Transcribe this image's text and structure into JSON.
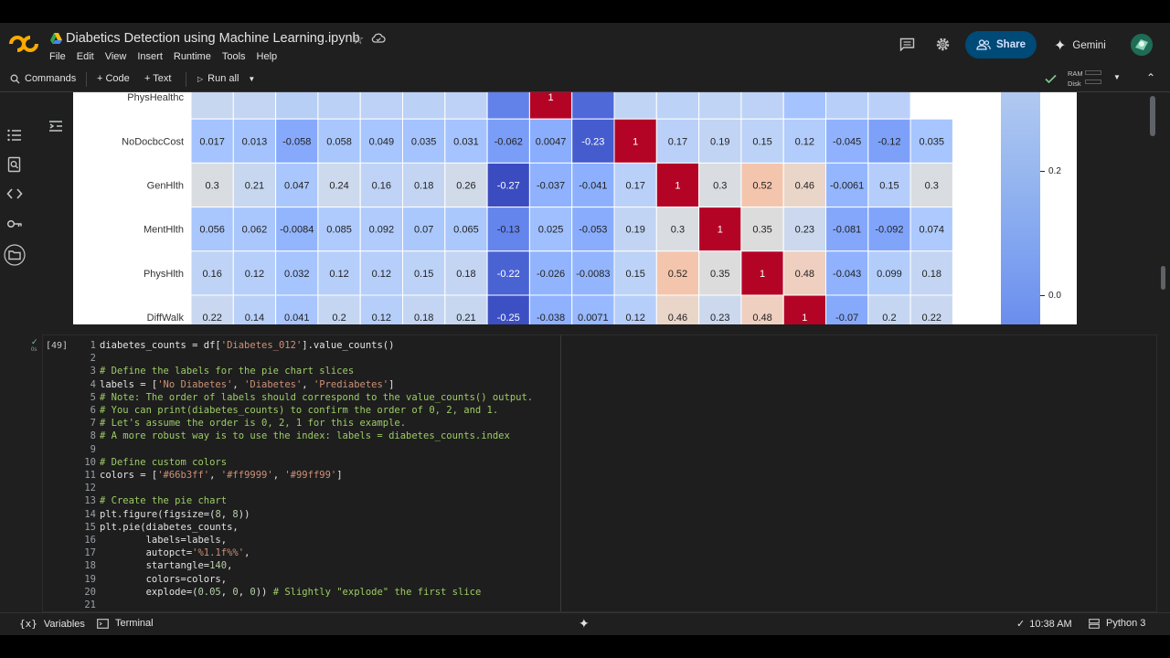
{
  "header": {
    "title": "Diabetics Detection using Machine Learning.ipynb",
    "menu": [
      "File",
      "Edit",
      "View",
      "Insert",
      "Runtime",
      "Tools",
      "Help"
    ],
    "share_label": "Share",
    "gemini_label": "Gemini"
  },
  "toolbar": {
    "commands_label": "Commands",
    "code_label": "+ Code",
    "text_label": "+ Text",
    "run_all_label": "Run all",
    "ram_label": "RAM",
    "disk_label": "Disk"
  },
  "heatmap": {
    "row_labels": [
      "PhysHealthc",
      "NoDocbcCost",
      "GenHlth",
      "MentHlth",
      "PhysHlth",
      "DiffWalk"
    ],
    "rows": [
      {
        "values": [
          "",
          "",
          "",
          "",
          "",
          "",
          "",
          "",
          "1",
          "",
          "",
          "",
          "",
          "",
          "",
          "",
          "",
          ""
        ],
        "colors": [
          "#c7d7f0",
          "#c4d5f3",
          "#b7cff5",
          "#bbd1f5",
          "#bdd2f6",
          "#bbd1f5",
          "#bdd2f6",
          "#6282ea",
          "#b40426",
          "#4f69d9",
          "#c0d4f5",
          "#bcd2f7",
          "#c0d4f5",
          "#bdd2f6",
          "#a5c3fe",
          "#b7cff9",
          "#bad0f8"
        ]
      },
      {
        "values": [
          "0.017",
          "0.013",
          "-0.058",
          "0.058",
          "0.049",
          "0.035",
          "0.031",
          "-0.062",
          "0.0047",
          "-0.23",
          "1",
          "0.17",
          "0.19",
          "0.15",
          "0.12",
          "-0.045",
          "-0.12",
          "0.035"
        ],
        "colors": [
          "#a5c3fe",
          "#a3c2fe",
          "#86a9fc",
          "#a9c6fd",
          "#a7c5fe",
          "#a5c3fe",
          "#a5c3fe",
          "#7a9df8",
          "#8badfd",
          "#455cce",
          "#b40426",
          "#bad0f8",
          "#c1d4f4",
          "#bcd2f7",
          "#b2ccfb",
          "#90b2fe",
          "#7da0f9",
          "#a7c5fe"
        ]
      },
      {
        "values": [
          "0.3",
          "0.21",
          "0.047",
          "0.24",
          "0.16",
          "0.18",
          "0.26",
          "-0.27",
          "-0.037",
          "-0.041",
          "0.17",
          "1",
          "0.3",
          "0.52",
          "0.46",
          "-0.0061",
          "0.15",
          "0.3"
        ],
        "colors": [
          "#d9dce1",
          "#c7d7f0",
          "#aac7fd",
          "#cdd9ec",
          "#bfd3f6",
          "#c4d5f3",
          "#d1dae9",
          "#3b4cc0",
          "#8fb1fe",
          "#8db0fe",
          "#b9d0f9",
          "#b40426",
          "#d9dce1",
          "#f4c5ad",
          "#ead5c9",
          "#94b6ff",
          "#b5cdfa",
          "#d9dce1"
        ]
      },
      {
        "values": [
          "0.056",
          "0.062",
          "-0.0084",
          "0.085",
          "0.092",
          "0.07",
          "0.065",
          "-0.13",
          "0.025",
          "-0.053",
          "0.19",
          "0.3",
          "1",
          "0.35",
          "0.23",
          "-0.081",
          "-0.092",
          "0.074"
        ],
        "colors": [
          "#a9c6fd",
          "#aac7fd",
          "#93b5fe",
          "#afcafc",
          "#b1cbfc",
          "#abc8fd",
          "#abc8fd",
          "#6485ec",
          "#9fbfff",
          "#89acfd",
          "#c1d4f4",
          "#d9dce1",
          "#b40426",
          "#dddcdc",
          "#cbd8ee",
          "#84a7fc",
          "#81a4fb",
          "#adc9fd"
        ]
      },
      {
        "values": [
          "0.16",
          "0.12",
          "0.032",
          "0.12",
          "0.12",
          "0.15",
          "0.18",
          "-0.22",
          "-0.026",
          "-0.0083",
          "0.15",
          "0.52",
          "0.35",
          "1",
          "0.48",
          "-0.043",
          "0.099",
          "0.18"
        ],
        "colors": [
          "#bfd3f6",
          "#b6cefa",
          "#a6c4fe",
          "#b6cefa",
          "#b6cefa",
          "#bcd2f7",
          "#c4d5f3",
          "#4a63d3",
          "#92b4fe",
          "#93b5fe",
          "#bcd2f7",
          "#f4c5ad",
          "#dddcdc",
          "#b40426",
          "#efcfbf",
          "#8fb1fe",
          "#b3cdfb",
          "#c4d5f3"
        ]
      },
      {
        "values": [
          "0.22",
          "0.14",
          "0.041",
          "0.2",
          "0.12",
          "0.18",
          "0.21",
          "-0.25",
          "-0.038",
          "0.0071",
          "0.12",
          "0.46",
          "0.23",
          "0.48",
          "1",
          "-0.07",
          "0.2",
          "0.22"
        ],
        "colors": [
          "#c9d7f0",
          "#b9d0f9",
          "#a8c5fe",
          "#c5d6f2",
          "#b6cefa",
          "#c4d5f3",
          "#c7d7f0",
          "#3d50c3",
          "#8fb1fe",
          "#98b9ff",
          "#b6cefa",
          "#ead5c9",
          "#cbd8ee",
          "#efcfbf",
          "#b40426",
          "#86a9fc",
          "#c5d6f2",
          "#c9d7f0"
        ]
      }
    ],
    "colorbar_ticks": [
      "0.2",
      "0.0"
    ]
  },
  "cell": {
    "exec_count": "[49]",
    "run_time": "0s",
    "lines": [
      {
        "n": "1",
        "parts": [
          [
            "",
            "diabetes_counts = df["
          ],
          [
            "st",
            "'Diabetes_012'"
          ],
          [
            "",
            "].value_counts()"
          ]
        ]
      },
      {
        "n": "2",
        "parts": [
          [
            "",
            ""
          ]
        ]
      },
      {
        "n": "3",
        "parts": [
          [
            "cm",
            "# Define the labels for the pie chart slices"
          ]
        ]
      },
      {
        "n": "4",
        "parts": [
          [
            "",
            "labels = ["
          ],
          [
            "st",
            "'No Diabetes'"
          ],
          [
            "",
            ", "
          ],
          [
            "st",
            "'Diabetes'"
          ],
          [
            "",
            ", "
          ],
          [
            "st",
            "'Prediabetes'"
          ],
          [
            "",
            "]"
          ]
        ]
      },
      {
        "n": "5",
        "parts": [
          [
            "cm",
            "# Note: The order of labels should correspond to the value_counts() output."
          ]
        ]
      },
      {
        "n": "6",
        "parts": [
          [
            "cm",
            "# You can print(diabetes_counts) to confirm the order of 0, 2, and 1."
          ]
        ]
      },
      {
        "n": "7",
        "parts": [
          [
            "cm",
            "# Let's assume the order is 0, 2, 1 for this example."
          ]
        ]
      },
      {
        "n": "8",
        "parts": [
          [
            "cm",
            "# A more robust way is to use the index: labels = diabetes_counts.index"
          ]
        ]
      },
      {
        "n": "9",
        "parts": [
          [
            "",
            ""
          ]
        ]
      },
      {
        "n": "10",
        "parts": [
          [
            "cm",
            "# Define custom colors"
          ]
        ]
      },
      {
        "n": "11",
        "parts": [
          [
            "",
            "colors = ["
          ],
          [
            "st",
            "'#66b3ff'"
          ],
          [
            "",
            ", "
          ],
          [
            "st",
            "'#ff9999'"
          ],
          [
            "",
            ", "
          ],
          [
            "st",
            "'#99ff99'"
          ],
          [
            "",
            "]"
          ]
        ]
      },
      {
        "n": "12",
        "parts": [
          [
            "",
            ""
          ]
        ]
      },
      {
        "n": "13",
        "parts": [
          [
            "cm",
            "# Create the pie chart"
          ]
        ]
      },
      {
        "n": "14",
        "parts": [
          [
            "",
            "plt.figure(figsize=("
          ],
          [
            "nm",
            "8"
          ],
          [
            "",
            ", "
          ],
          [
            "nm",
            "8"
          ],
          [
            "",
            "))"
          ]
        ]
      },
      {
        "n": "15",
        "parts": [
          [
            "",
            "plt.pie(diabetes_counts,"
          ]
        ]
      },
      {
        "n": "16",
        "parts": [
          [
            "",
            "        labels=labels,"
          ]
        ]
      },
      {
        "n": "17",
        "parts": [
          [
            "",
            "        autopct="
          ],
          [
            "st",
            "'%1.1f%%'"
          ],
          [
            "",
            ","
          ]
        ]
      },
      {
        "n": "18",
        "parts": [
          [
            "",
            "        startangle="
          ],
          [
            "nm",
            "140"
          ],
          [
            "",
            ","
          ]
        ]
      },
      {
        "n": "19",
        "parts": [
          [
            "",
            "        colors=colors,"
          ]
        ]
      },
      {
        "n": "20",
        "parts": [
          [
            "",
            "        explode=("
          ],
          [
            "nm",
            "0.05"
          ],
          [
            "",
            ", "
          ],
          [
            "nm",
            "0"
          ],
          [
            "",
            ", "
          ],
          [
            "nm",
            "0"
          ],
          [
            "",
            ")) "
          ],
          [
            "cm",
            "# Slightly \"explode\" the first slice"
          ]
        ]
      },
      {
        "n": "21",
        "parts": [
          [
            "",
            ""
          ]
        ]
      }
    ]
  },
  "statusbar": {
    "variables_label": "Variables",
    "terminal_label": "Terminal",
    "time": "10:38 AM",
    "runtime_label": "Python 3"
  },
  "colors": {
    "accent": "#004a77",
    "background": "#1f1f1f",
    "comment": "#9ccc65"
  }
}
